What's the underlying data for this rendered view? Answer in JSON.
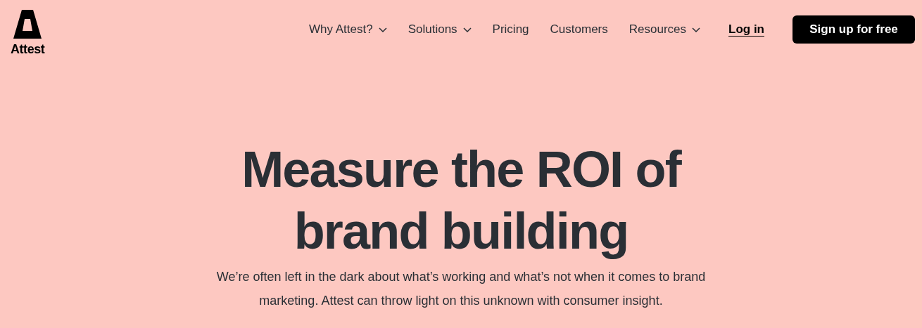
{
  "logo": {
    "text": "Attest"
  },
  "nav": [
    {
      "label": "Why Attest?",
      "has_menu": true
    },
    {
      "label": "Solutions",
      "has_menu": true
    },
    {
      "label": "Pricing",
      "has_menu": false
    },
    {
      "label": "Customers",
      "has_menu": false
    },
    {
      "label": "Resources",
      "has_menu": true
    }
  ],
  "login": "Log in",
  "signup": "Sign up for free",
  "hero": {
    "title": "Measure the ROI of brand building",
    "subtitle": "We’re often left in the dark about what’s working and what’s not when it comes to brand marketing. Attest can throw light on this unknown with consumer insight."
  }
}
